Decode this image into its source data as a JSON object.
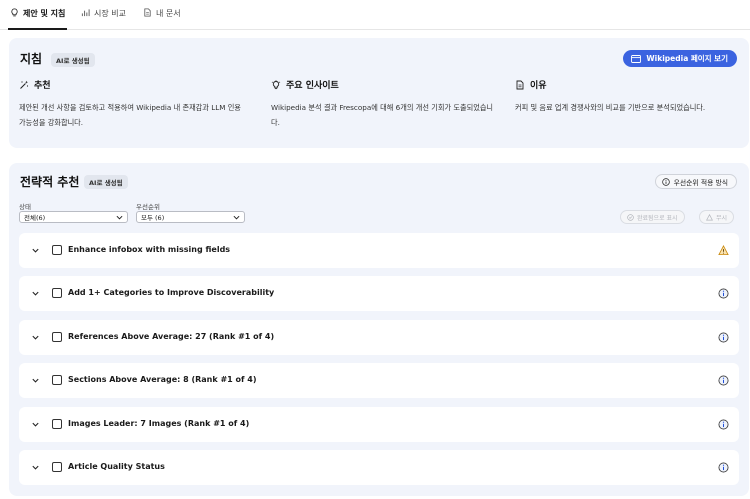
{
  "tabs": [
    {
      "label": "제안 및 지침",
      "icon": "lightbulb-icon",
      "active": true
    },
    {
      "label": "시장 비교",
      "icon": "bar-chart-icon",
      "active": false
    },
    {
      "label": "내 문서",
      "icon": "document-icon",
      "active": false
    }
  ],
  "guidance": {
    "title": "지침",
    "badge": "AI로 생성됨",
    "wiki_button": "Wikipedia 페이지 보기",
    "columns": [
      {
        "title": "추천",
        "icon": "magic-wand-icon",
        "body": "제안된 개선 사항을 검토하고 적용하여 Wikipedia 내 존재감과 LLM 인용 가능성을 강화합니다."
      },
      {
        "title": "주요 인사이트",
        "icon": "lightbulb-icon",
        "body": "Wikipedia 분석 결과 Frescopa에 대해 6개의 개선 기회가 도출되었습니다."
      },
      {
        "title": "이유",
        "icon": "document-icon",
        "body": "커피 및 음료 업계 경쟁사와의 비교를 기반으로 분석되었습니다."
      }
    ]
  },
  "strategic": {
    "title": "전략적 추천",
    "badge": "AI로 생성됨",
    "method_button": "우선순위 적용 방식",
    "filters": {
      "status_label": "상태",
      "status_value": "전체(6)",
      "priority_label": "우선순위",
      "priority_value": "모두 (6)"
    },
    "actions": {
      "mark_complete": "완료됨으로 표시",
      "ignore": "무시"
    },
    "items": [
      {
        "title": "Enhance infobox with missing fields",
        "status_icon": "warning-icon"
      },
      {
        "title": "Add 1+ Categories to Improve Discoverability",
        "status_icon": "info-icon"
      },
      {
        "title": "References Above Average: 27 (Rank #1 of 4)",
        "status_icon": "info-icon"
      },
      {
        "title": "Sections Above Average: 8 (Rank #1 of 4)",
        "status_icon": "info-icon"
      },
      {
        "title": "Images Leader: 7 Images (Rank #1 of 4)",
        "status_icon": "info-icon"
      },
      {
        "title": "Article Quality Status",
        "status_icon": "info-icon"
      }
    ]
  },
  "colors": {
    "accent": "#3b63e0",
    "card_bg": "#f1f4fb",
    "warning": "#e8a317",
    "info": "#1f4fd8"
  }
}
